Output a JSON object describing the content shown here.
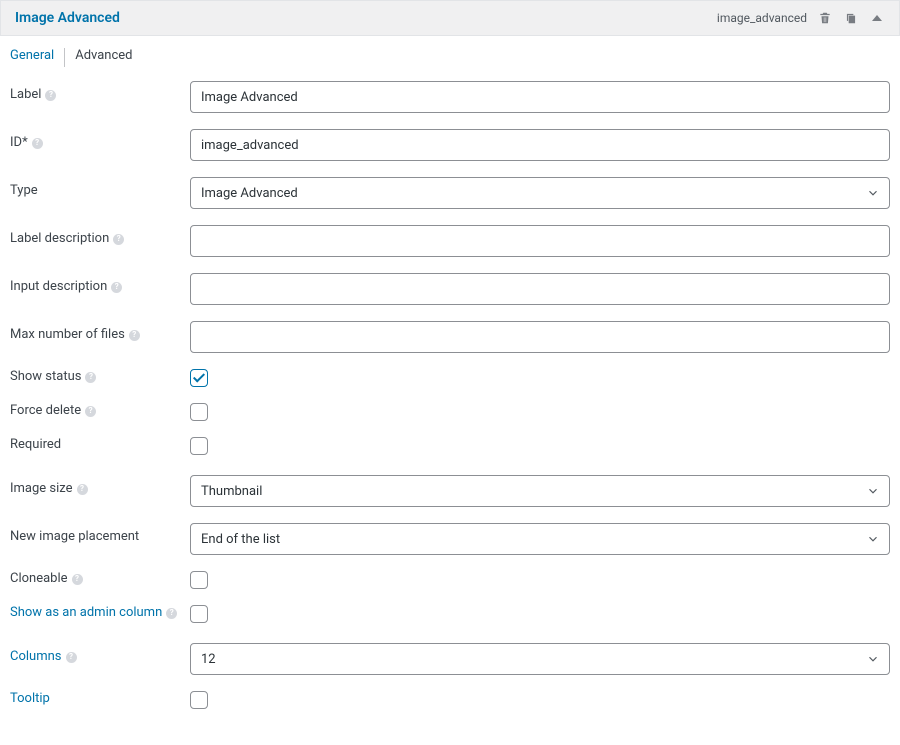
{
  "header": {
    "title": "Image Advanced",
    "id_text": "image_advanced"
  },
  "tabs": {
    "general": "General",
    "advanced": "Advanced"
  },
  "fields": {
    "label": {
      "label": "Label",
      "value": "Image Advanced"
    },
    "id": {
      "label": "ID*",
      "value": "image_advanced"
    },
    "type": {
      "label": "Type",
      "value": "Image Advanced"
    },
    "label_description": {
      "label": "Label description",
      "value": ""
    },
    "input_description": {
      "label": "Input description",
      "value": ""
    },
    "max_files": {
      "label": "Max number of files",
      "value": ""
    },
    "show_status": {
      "label": "Show status"
    },
    "force_delete": {
      "label": "Force delete"
    },
    "required": {
      "label": "Required"
    },
    "image_size": {
      "label": "Image size",
      "value": "Thumbnail"
    },
    "new_image_placement": {
      "label": "New image placement",
      "value": "End of the list"
    },
    "cloneable": {
      "label": "Cloneable"
    },
    "show_admin_column": {
      "label": "Show as an admin column"
    },
    "columns": {
      "label": "Columns",
      "value": "12"
    },
    "tooltip": {
      "label": "Tooltip"
    }
  },
  "help_glyph": "?"
}
